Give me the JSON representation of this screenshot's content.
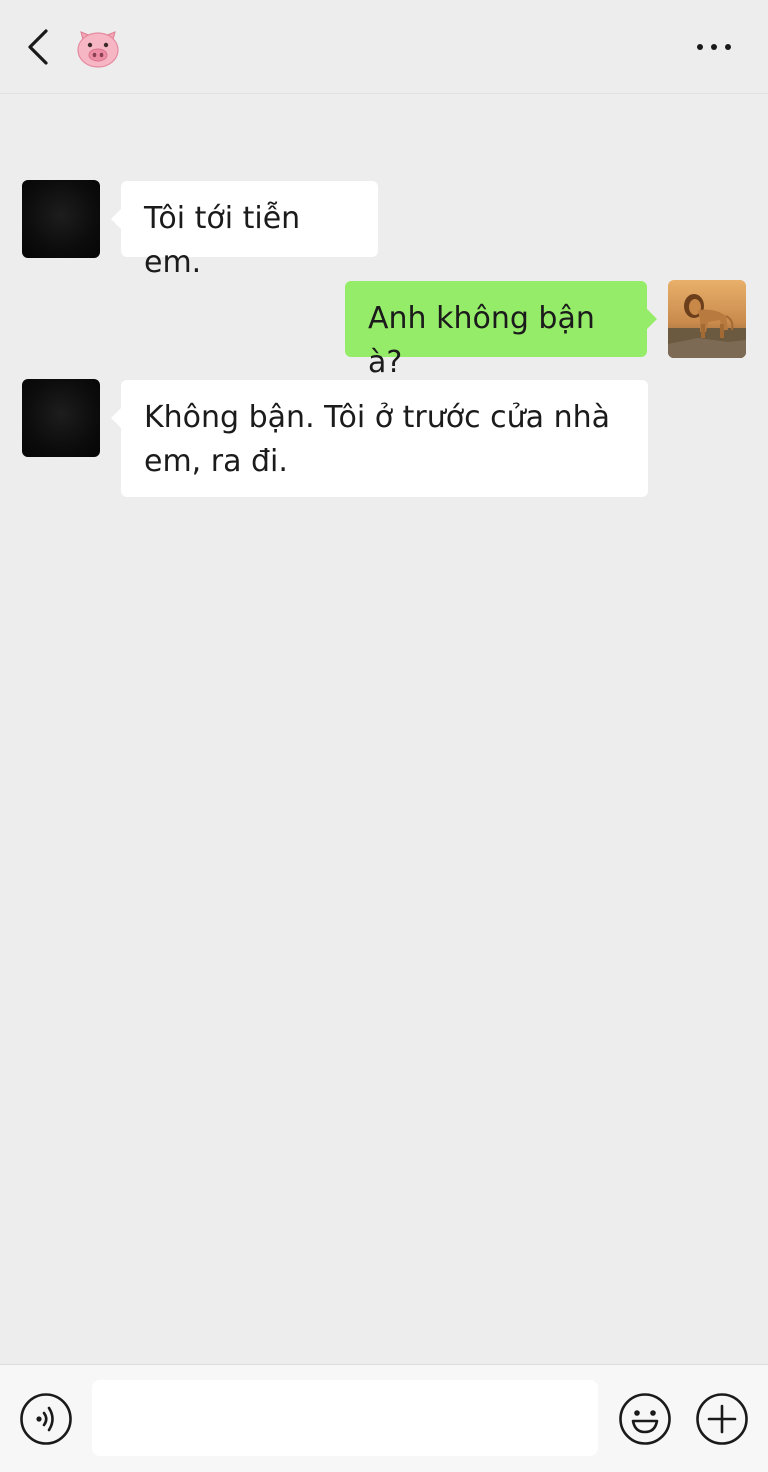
{
  "header": {
    "contact_icon": "pig-face-emoji",
    "back_icon": "chevron-left-icon",
    "more_icon": "more-dots-icon"
  },
  "messages": [
    {
      "direction": "incoming",
      "avatar": "dark-square-avatar",
      "text": "Tôi tới tiễn em."
    },
    {
      "direction": "outgoing",
      "avatar": "lion-photo-avatar",
      "text": "Anh không bận à?"
    },
    {
      "direction": "incoming",
      "avatar": "dark-square-avatar",
      "text_line1": "Không bận. Tôi ở trước cửa nhà",
      "text_line2": "em, ra đi."
    }
  ],
  "composer": {
    "input_value": "",
    "voice_icon": "voice-icon",
    "emoji_icon": "smiley-icon",
    "add_icon": "plus-circle-icon"
  },
  "colors": {
    "background": "#ededed",
    "outgoing_bubble": "#95ec69",
    "incoming_bubble": "#ffffff",
    "bottom_bar": "#f7f7f7"
  }
}
